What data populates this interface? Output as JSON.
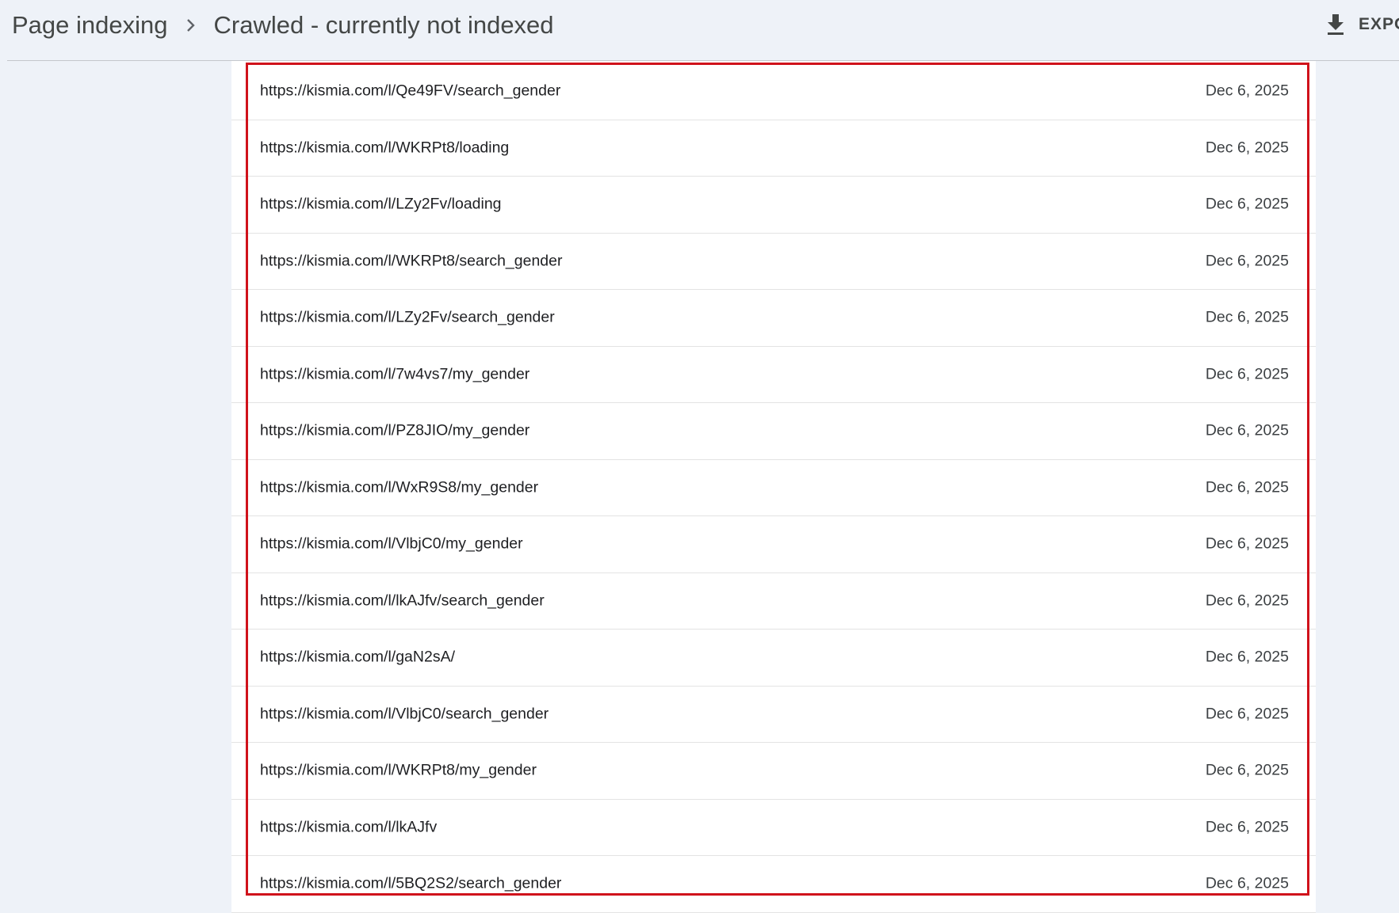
{
  "breadcrumb": {
    "parent": "Page indexing",
    "separator_icon": "chevron-right-icon",
    "current": "Crawled - currently not indexed"
  },
  "toolbar": {
    "export_icon": "download-icon",
    "export_label": "EXPO"
  },
  "colors": {
    "page_background": "#eef2f8",
    "card_background": "#ffffff",
    "highlight_border": "#d0121b",
    "row_divider": "#e3e3e3"
  },
  "table": {
    "rows": [
      {
        "url": "https://kismia.com/l/Qe49FV/search_gender",
        "date": "Dec 6, 2025"
      },
      {
        "url": "https://kismia.com/l/WKRPt8/loading",
        "date": "Dec 6, 2025"
      },
      {
        "url": "https://kismia.com/l/LZy2Fv/loading",
        "date": "Dec 6, 2025"
      },
      {
        "url": "https://kismia.com/l/WKRPt8/search_gender",
        "date": "Dec 6, 2025"
      },
      {
        "url": "https://kismia.com/l/LZy2Fv/search_gender",
        "date": "Dec 6, 2025"
      },
      {
        "url": "https://kismia.com/l/7w4vs7/my_gender",
        "date": "Dec 6, 2025"
      },
      {
        "url": "https://kismia.com/l/PZ8JIO/my_gender",
        "date": "Dec 6, 2025"
      },
      {
        "url": "https://kismia.com/l/WxR9S8/my_gender",
        "date": "Dec 6, 2025"
      },
      {
        "url": "https://kismia.com/l/VlbjC0/my_gender",
        "date": "Dec 6, 2025"
      },
      {
        "url": "https://kismia.com/l/lkAJfv/search_gender",
        "date": "Dec 6, 2025"
      },
      {
        "url": "https://kismia.com/l/gaN2sA/",
        "date": "Dec 6, 2025"
      },
      {
        "url": "https://kismia.com/l/VlbjC0/search_gender",
        "date": "Dec 6, 2025"
      },
      {
        "url": "https://kismia.com/l/WKRPt8/my_gender",
        "date": "Dec 6, 2025"
      },
      {
        "url": "https://kismia.com/l/lkAJfv",
        "date": "Dec 6, 2025"
      },
      {
        "url": "https://kismia.com/l/5BQ2S2/search_gender",
        "date": "Dec 6, 2025"
      }
    ]
  }
}
